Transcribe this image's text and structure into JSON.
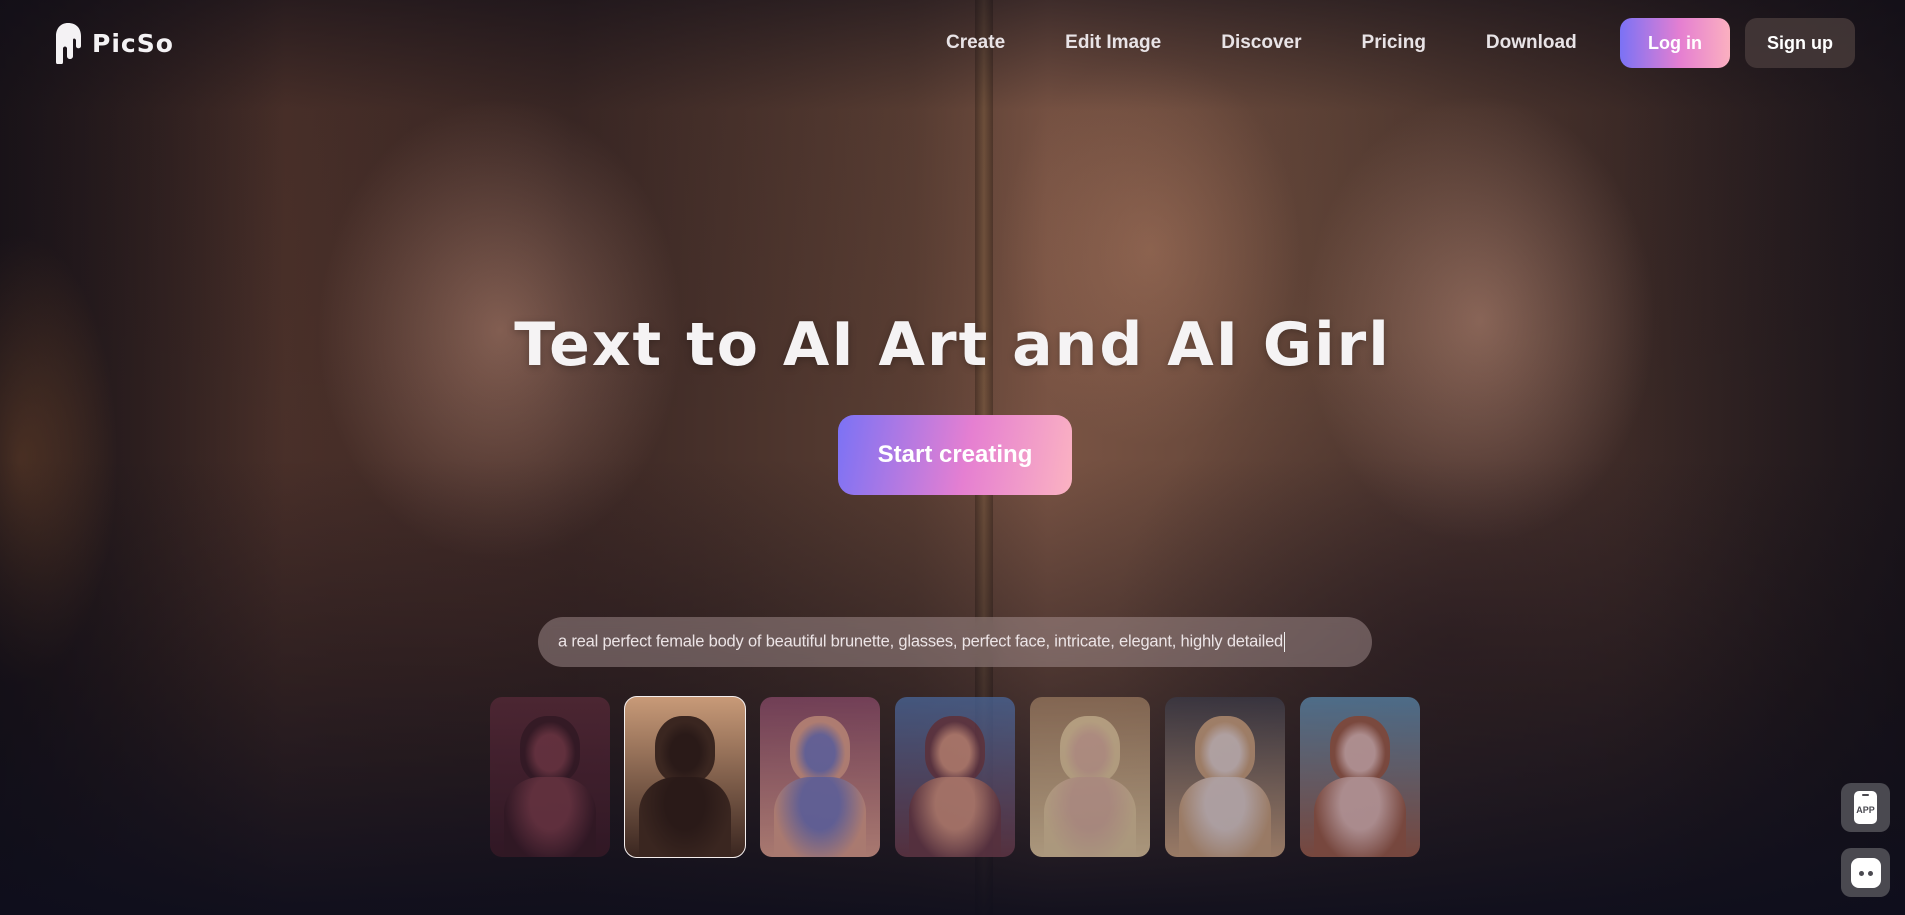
{
  "brand": {
    "name": "PicSo",
    "logo_icon": "drip-logo-icon"
  },
  "nav": {
    "items": [
      {
        "label": "Create"
      },
      {
        "label": "Edit Image"
      },
      {
        "label": "Discover"
      },
      {
        "label": "Pricing"
      },
      {
        "label": "Download"
      }
    ],
    "login_label": "Log in",
    "signup_label": "Sign up"
  },
  "hero": {
    "title": "Text to AI Art and AI Girl",
    "cta_label": "Start creating",
    "prompt_text": "a real perfect female body of beautiful brunette, glasses, perfect face, intricate, elegant, highly detailed"
  },
  "thumbnails": {
    "selected_index": 1,
    "items": [
      {
        "alt": "dark red fantasy scene",
        "colors": [
          "#5a2a3a",
          "#3a1a28",
          "#7a3a4a"
        ]
      },
      {
        "alt": "brunette with glasses",
        "colors": [
          "#c89a78",
          "#3a2620",
          "#2a1a18"
        ]
      },
      {
        "alt": "anime girl pink hair",
        "colors": [
          "#8a4a6a",
          "#e0a090",
          "#7a7ac0"
        ]
      },
      {
        "alt": "brunette with blue swimsuit",
        "colors": [
          "#4a6aa0",
          "#6a3a4a",
          "#d09080"
        ]
      },
      {
        "alt": "blonde in corset",
        "colors": [
          "#9a7a60",
          "#e0c8a0",
          "#d8b0a0"
        ]
      },
      {
        "alt": "blonde in lingerie",
        "colors": [
          "#3a3a48",
          "#c8a080",
          "#e0d0d0"
        ]
      },
      {
        "alt": "anime girl by pool",
        "colors": [
          "#5a8ab0",
          "#9a5a4a",
          "#e0b8b8"
        ]
      }
    ]
  },
  "side_buttons": {
    "app_label": "APP",
    "chat_icon": "chat-bot-icon"
  },
  "colors": {
    "accent_gradient_start": "#7b72f5",
    "accent_gradient_mid": "#e57fd1",
    "accent_gradient_end": "#fbb0c0",
    "signup_bg": "#463a3a",
    "side_button_bg": "#4a4950"
  }
}
